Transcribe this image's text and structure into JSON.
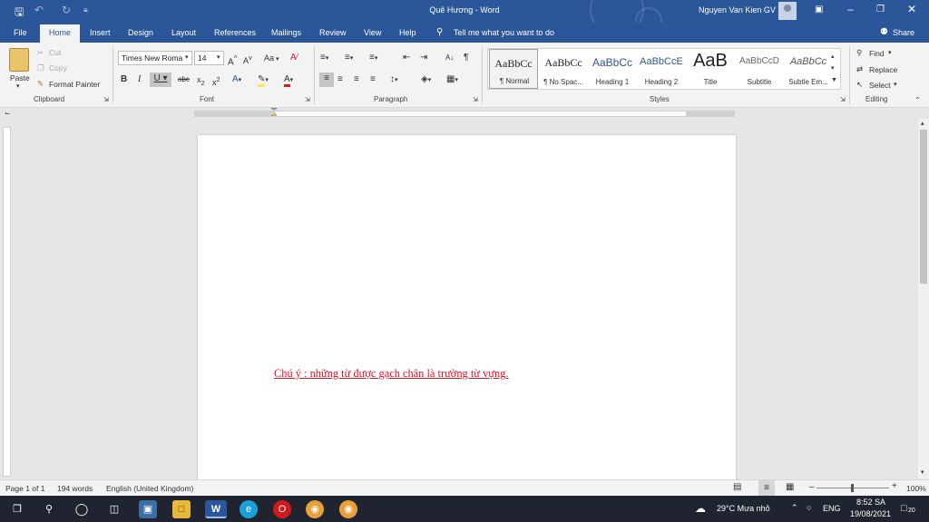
{
  "titlebar": {
    "doc_title": "Quê Hương  -  Word",
    "user": "Nguyen Van Kien GV",
    "save_icon": "save-icon",
    "undo_icon": "undo-icon",
    "redo_icon": "redo-icon",
    "customize_icon": "customize-quick-access-icon"
  },
  "tabs": [
    {
      "label": "File"
    },
    {
      "label": "Home"
    },
    {
      "label": "Insert"
    },
    {
      "label": "Design"
    },
    {
      "label": "Layout"
    },
    {
      "label": "References"
    },
    {
      "label": "Mailings"
    },
    {
      "label": "Review"
    },
    {
      "label": "View"
    },
    {
      "label": "Help"
    }
  ],
  "tell_me": "Tell me what you want to do",
  "share": "Share",
  "clipboard": {
    "paste": "Paste",
    "cut": "Cut",
    "copy": "Copy",
    "format_painter": "Format Painter",
    "label": "Clipboard"
  },
  "font": {
    "name": "Times New Roma",
    "size": "14",
    "label": "Font",
    "aa_label": "Aa"
  },
  "paragraph": {
    "label": "Paragraph"
  },
  "styles": {
    "label": "Styles",
    "items": [
      {
        "preview": "AaBbCc",
        "name": "¶ Normal"
      },
      {
        "preview": "AaBbCc",
        "name": "¶ No Spac..."
      },
      {
        "preview": "AaBbCc",
        "name": "Heading 1"
      },
      {
        "preview": "AaBbCcE",
        "name": "Heading 2"
      },
      {
        "preview": "AaB",
        "name": "Title"
      },
      {
        "preview": "AaBbCcD",
        "name": "Subtitle"
      },
      {
        "preview": "AaBbCc",
        "name": "Subtle Em..."
      }
    ]
  },
  "editing": {
    "label": "Editing",
    "find": "Find",
    "replace": "Replace",
    "select": "Select"
  },
  "document": {
    "note": "Chú ý : những từ được gạch chân là trường từ vựng."
  },
  "statusbar": {
    "page": "Page 1 of 1",
    "words": "194 words",
    "language": "English (United Kingdom)",
    "zoom": "100%"
  },
  "taskbar": {
    "weather": "29°C  Mưa nhỏ",
    "lang": "ENG",
    "time": "8:52 SA",
    "date": "19/08/2021",
    "notifications": "20"
  }
}
